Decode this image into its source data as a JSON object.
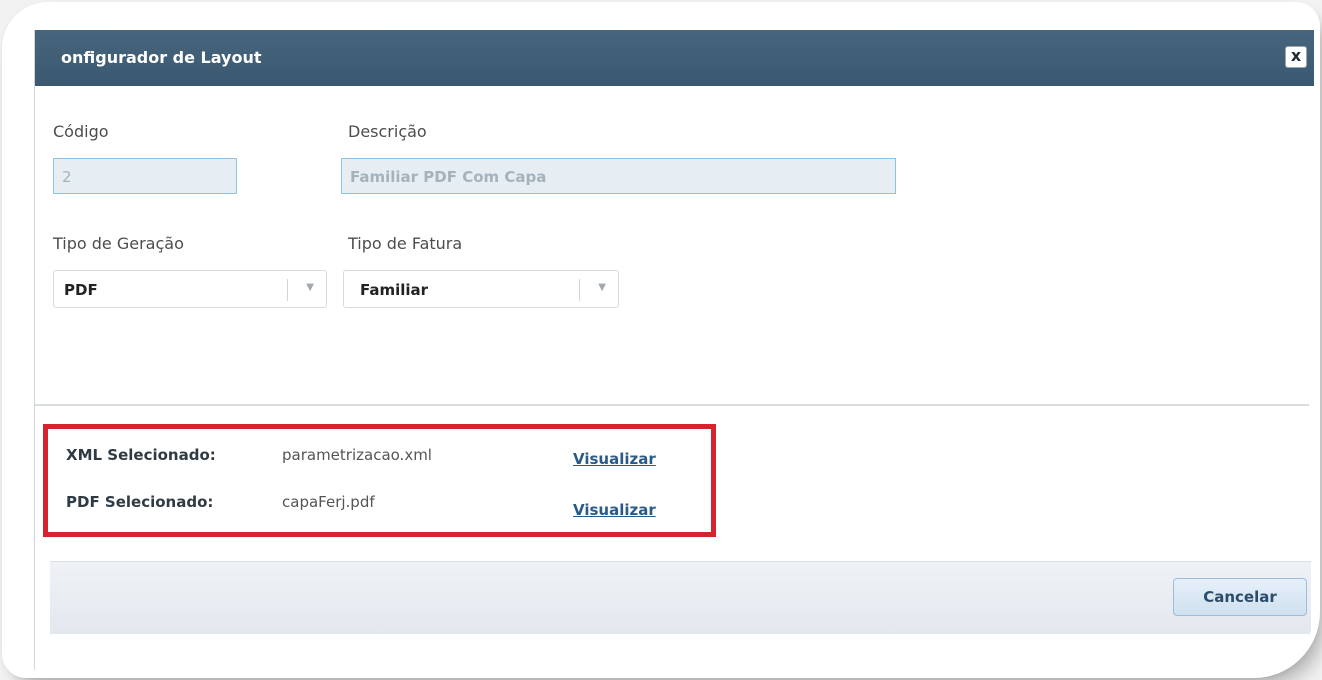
{
  "dialog": {
    "title": "onfigurador de Layout",
    "close_label": "x"
  },
  "form": {
    "codigo_label": "Código",
    "codigo_value": "2",
    "descricao_label": "Descrição",
    "descricao_value": "Familiar PDF Com Capa",
    "tipo_geracao_label": "Tipo de Geração",
    "tipo_geracao_value": "PDF",
    "tipo_fatura_label": "Tipo de Fatura",
    "tipo_fatura_value": "Familiar"
  },
  "files": {
    "xml_label": "XML Selecionado:",
    "xml_file": "parametrizacao.xml",
    "xml_link": "Visualizar",
    "pdf_label": "PDF Selecionado:",
    "pdf_file": "capaFerj.pdf",
    "pdf_link": "Visualizar"
  },
  "footer": {
    "cancel_label": "Cancelar"
  },
  "colors": {
    "titlebar": "#3f5e76",
    "highlight": "#d7232e",
    "link": "#2a5a8a"
  }
}
